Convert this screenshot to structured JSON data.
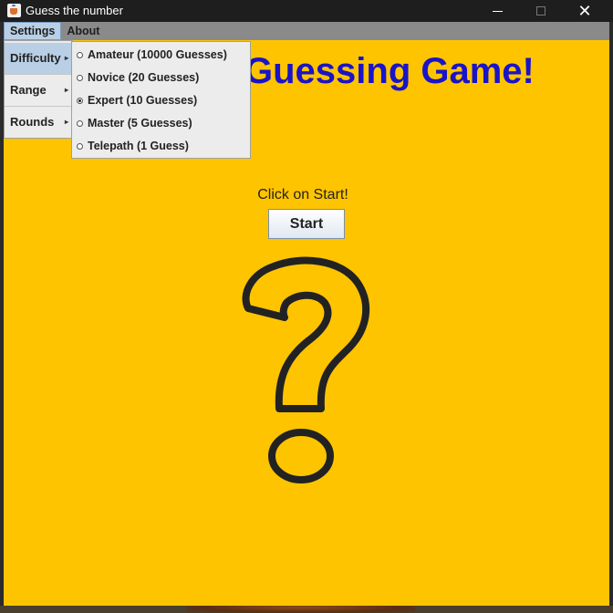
{
  "window": {
    "title": "Guess the number",
    "close_glyph": "✕"
  },
  "menubar": {
    "items": [
      {
        "label": "Settings",
        "active": true
      },
      {
        "label": "About",
        "active": false
      }
    ]
  },
  "settings_menu": {
    "items": [
      {
        "label": "Difficulty",
        "arrow": "▸",
        "active": true
      },
      {
        "label": "Range",
        "arrow": "▸",
        "active": false
      },
      {
        "label": "Rounds",
        "arrow": "▸",
        "active": false
      }
    ]
  },
  "difficulty_menu": {
    "options": [
      {
        "label": "Amateur (10000 Guesses)",
        "selected": false
      },
      {
        "label": "Novice (20 Guesses)",
        "selected": false
      },
      {
        "label": "Expert (10 Guesses)",
        "selected": true
      },
      {
        "label": "Master (5 Guesses)",
        "selected": false
      },
      {
        "label": "Telepath (1 Guess)",
        "selected": false
      }
    ]
  },
  "content": {
    "title": "Guessing Game!",
    "prompt": "Click on Start!",
    "start_label": "Start",
    "illustration": "question-mark-icon"
  },
  "colors": {
    "content_bg": "#ffc400",
    "title_color": "#1a14c8",
    "menu_highlight": "#b8cfe5",
    "titlebar_bg": "#1e1e1e"
  }
}
